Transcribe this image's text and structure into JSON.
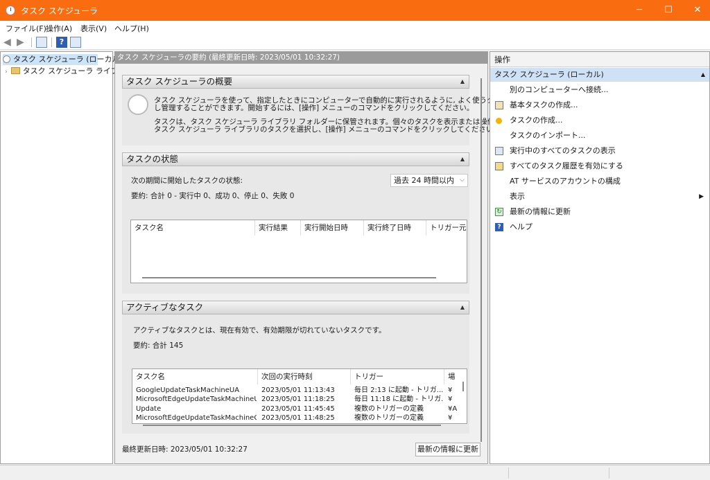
{
  "window": {
    "title": "タスク スケジューラ",
    "controls": [
      "─",
      "☐",
      "✕"
    ]
  },
  "menu": [
    "ファイル(F)",
    "操作(A)",
    "表示(V)",
    "ヘルプ(H)"
  ],
  "tree": {
    "root": "タスク スケジューラ (ローカル)",
    "child": "タスク スケジューラ ライブラリ"
  },
  "center": {
    "header": "タスク スケジューラの要約 (最終更新日時: 2023/05/01 10:32:27)",
    "overview": {
      "title": "タスク スケジューラの概要",
      "para1_line1": "タスク スケジューラを使って、指定したときにコンピューターで自動的に実行されるように, よく使うタスクを作成",
      "para1_line2": "し管理することができます。開始するには、[操作] メニューのコマンドをクリックしてください。",
      "para2_line1": "タスクは、タスク スケジューラ ライブラリ フォルダーに保管されます。個々のタスクを表示または操作するには、",
      "para2_line2": "タスク スケジューラ ライブラリのタスクを選択し、[操作] メニューのコマンドをクリックしてください。"
    },
    "status": {
      "title": "タスクの状態",
      "period_label": "次の期間に開始したタスクの状態:",
      "period_value": "過去 24 時間以内",
      "summary": "要約: 合計 0 - 実行中 0、成功 0、停止 0、失敗 0",
      "columns": [
        "タスク名",
        "実行結果",
        "実行開始日時",
        "実行終了日時",
        "トリガー元"
      ]
    },
    "active": {
      "title": "アクティブなタスク",
      "desc": "アクティブなタスクとは、現在有効で、有効期限が切れていないタスクです。",
      "summary": "要約: 合計 145",
      "columns": [
        "タスク名",
        "次回の実行時刻",
        "トリガー",
        "場"
      ],
      "rows": [
        [
          "GoogleUpdateTaskMachineUA",
          "2023/05/01 11:13:43",
          "毎日 2:13 に起動 - トリガ...",
          "¥"
        ],
        [
          "MicrosoftEdgeUpdateTaskMachineUA",
          "2023/05/01 11:18:25",
          "毎日 11:18 に起動 - トリガ...",
          "¥"
        ],
        [
          "Update",
          "2023/05/01 11:45:45",
          "複数のトリガーの定義",
          "¥A"
        ],
        [
          "MicrosoftEdgeUpdateTaskMachineC",
          "2023/05/01 11:48:25",
          "複数のトリガーの定義",
          "¥"
        ]
      ]
    },
    "footer": {
      "last_updated": "最終更新日時: 2023/05/01 10:32:27",
      "refresh_button": "最新の情報に更新"
    }
  },
  "actions": {
    "title": "操作",
    "subtitle": "タスク スケジューラ (ローカル)",
    "items": [
      {
        "label": "別のコンピューターへ接続...",
        "icon": "none"
      },
      {
        "label": "基本タスクの作成...",
        "icon": "wizard-icon"
      },
      {
        "label": "タスクの作成...",
        "icon": "task-create-icon"
      },
      {
        "label": "タスクのインポート...",
        "icon": "none"
      },
      {
        "label": "実行中のすべてのタスクの表示",
        "icon": "running-tasks-icon"
      },
      {
        "label": "すべてのタスク履歴を有効にする",
        "icon": "history-icon"
      },
      {
        "label": "AT サービスのアカウントの構成",
        "icon": "none"
      },
      {
        "label": "表示",
        "icon": "none"
      },
      {
        "label": "最新の情報に更新",
        "icon": "refresh-icon"
      },
      {
        "label": "ヘルプ",
        "icon": "help-icon"
      }
    ]
  },
  "colors": {
    "titlebar": "#f96d10",
    "selection": "#cce4f7"
  }
}
